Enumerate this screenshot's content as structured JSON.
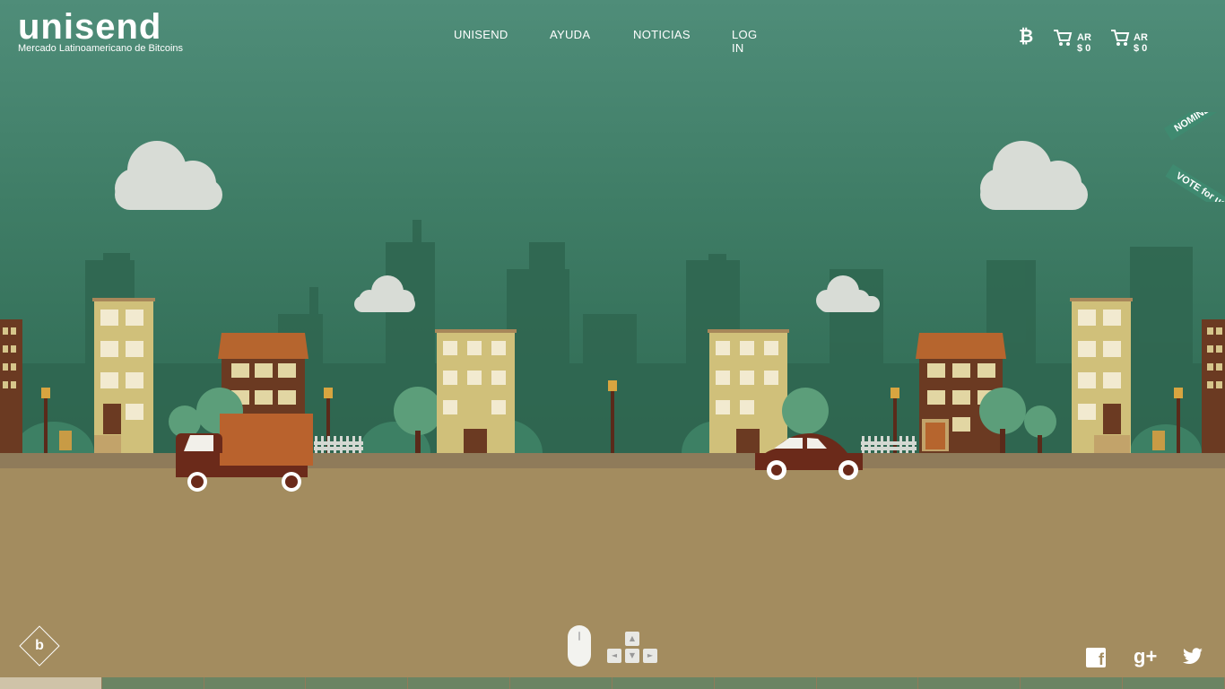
{
  "logo": {
    "word": "unisend",
    "tagline": "Mercado Latinoamericano de Bitcoins"
  },
  "nav": {
    "items": [
      "UNISEND",
      "AYUDA",
      "NOTICIAS",
      "LOG IN"
    ]
  },
  "topbar": {
    "bitcoin_icon": "bitcoin-icon",
    "cart_icon": "cart-icon",
    "amount_1": "AR $ 0",
    "amount_2": "AR $ 0"
  },
  "ribbon": {
    "nominee": "NOMINEE",
    "vote": "VOTE for us"
  },
  "brand_button": {
    "letter": "b"
  },
  "scroll_hint": {
    "mouse_icon": "mouse-icon",
    "keys": [
      "▲",
      "◄",
      "▼",
      "►"
    ]
  },
  "social": {
    "facebook": "f",
    "googleplus": "g+",
    "twitter": "twitter-icon"
  },
  "colors": {
    "sky": "#4f8d79",
    "ground": "#a38c5f",
    "cloud": "#d8dcd6",
    "skyline": "#2d5f4c"
  },
  "progress": {
    "segments": 12,
    "active_index": 0
  }
}
